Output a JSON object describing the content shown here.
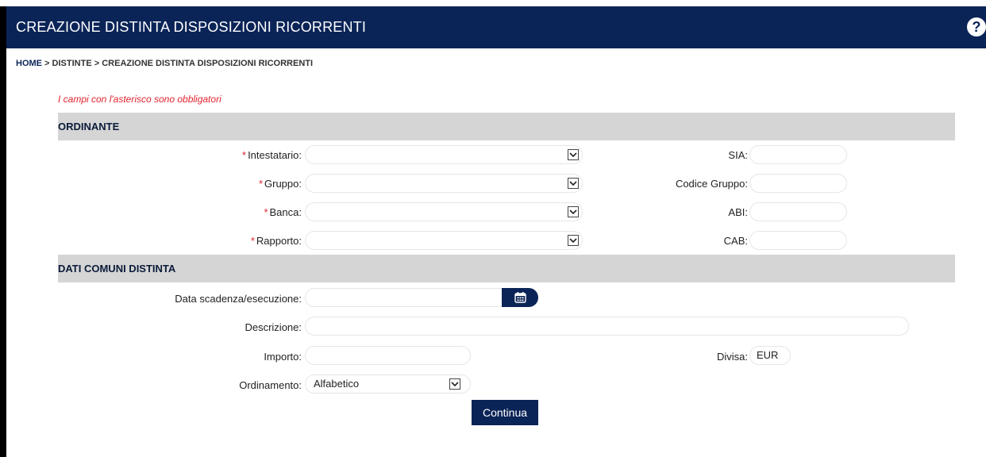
{
  "header": {
    "title": "CREAZIONE DISTINTA DISPOSIZIONI RICORRENTI",
    "help_icon": "?"
  },
  "breadcrumb": {
    "home": "HOME",
    "separator": " > ",
    "distinte": "DISTINTE",
    "current": "CREAZIONE DISTINTA DISPOSIZIONI RICORRENTI"
  },
  "required_note": "I campi con l'asterisco sono obbligatori",
  "sections": {
    "ordinante": "ORDINANTE",
    "dati_comuni": "DATI COMUNI DISTINTA"
  },
  "ordinante": {
    "asterisk": "*",
    "intestatario_label": "Intestatario:",
    "gruppo_label": "Gruppo:",
    "banca_label": "Banca:",
    "rapporto_label": "Rapporto:",
    "sia_label": "SIA:",
    "codice_gruppo_label": "Codice Gruppo:",
    "abi_label": "ABI:",
    "cab_label": "CAB:"
  },
  "dati_comuni": {
    "data_label": "Data scadenza/esecuzione:",
    "descrizione_label": "Descrizione:",
    "importo_label": "Importo:",
    "divisa_label": "Divisa:",
    "divisa_value": "EUR",
    "ordinamento_label": "Ordinamento:",
    "ordinamento_value": "Alfabetico"
  },
  "actions": {
    "continua": "Continua"
  },
  "colors": {
    "header_bg": "#0b2457",
    "section_bg": "#d5d5d5",
    "required": "#e0242f"
  }
}
